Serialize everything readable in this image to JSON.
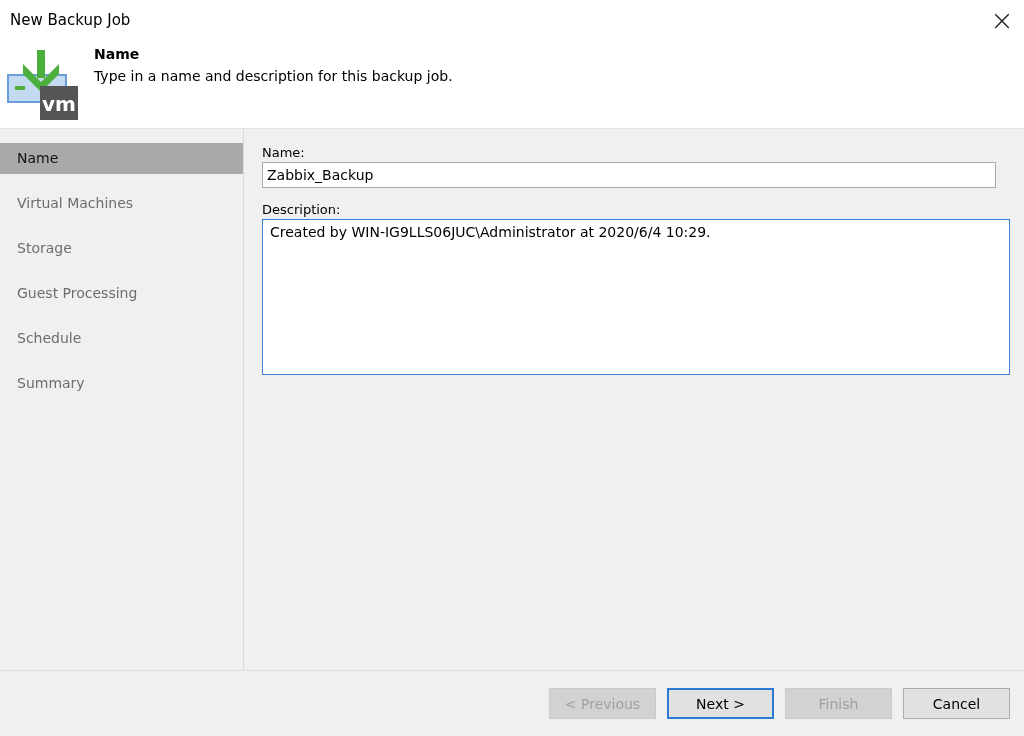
{
  "window": {
    "title": "New Backup Job",
    "close": "×"
  },
  "header": {
    "logo_text": "vm",
    "title": "Name",
    "subtitle": "Type in a name and description for this backup job."
  },
  "steps": [
    {
      "label": "Name",
      "selected": true
    },
    {
      "label": "Virtual Machines",
      "selected": false
    },
    {
      "label": "Storage",
      "selected": false
    },
    {
      "label": "Guest Processing",
      "selected": false
    },
    {
      "label": "Schedule",
      "selected": false
    },
    {
      "label": "Summary",
      "selected": false
    }
  ],
  "form": {
    "name_label": "Name:",
    "name_value": "Zabbix_Backup",
    "description_label": "Description:",
    "description_value": "Created by WIN-IG9LLS06JUC\\Administrator at 2020/6/4 10:29."
  },
  "buttons": [
    {
      "label": "< Previous",
      "disabled": true,
      "default": false
    },
    {
      "label": "Next >",
      "disabled": false,
      "default": true
    },
    {
      "label": "Finish",
      "disabled": true,
      "default": false
    },
    {
      "label": "Cancel",
      "disabled": false,
      "default": false
    }
  ]
}
